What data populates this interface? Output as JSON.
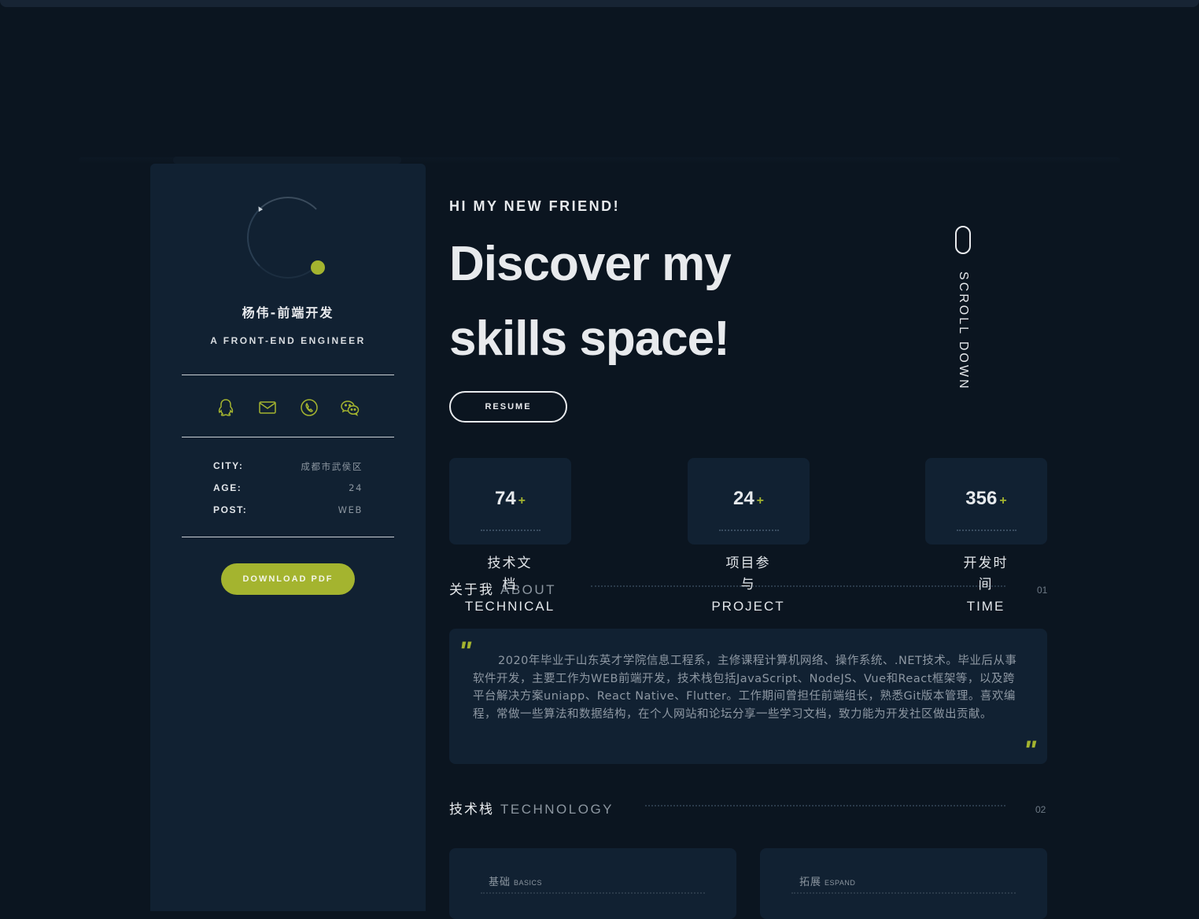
{
  "sidebar": {
    "name": "杨伟-前端开发",
    "role": "A FRONT-END ENGINEER",
    "socials": [
      {
        "icon": "qq-icon"
      },
      {
        "icon": "mail-icon"
      },
      {
        "icon": "phone-icon"
      },
      {
        "icon": "wechat-icon"
      }
    ],
    "info": [
      {
        "key": "CITY:",
        "value": "成都市武侯区"
      },
      {
        "key": "AGE:",
        "value": "24"
      },
      {
        "key": "POST:",
        "value": "WEB"
      }
    ],
    "download_label": "DOWNLOAD PDF"
  },
  "hero": {
    "greeting": "HI MY NEW FRIEND!",
    "headline_line1": "Discover my",
    "headline_line2": "skills space!",
    "resume_label": "RESUME",
    "scroll_label": "SCROLL DOWN"
  },
  "stats": [
    {
      "value": "74",
      "plus": "+",
      "label_cn": "技术文档",
      "label_en": "TECHNICAL"
    },
    {
      "value": "24",
      "plus": "+",
      "label_cn": "项目参与",
      "label_en": "PROJECT"
    },
    {
      "value": "356",
      "plus": "+",
      "label_cn": "开发时间",
      "label_en": "TIME"
    }
  ],
  "about": {
    "title_cn": "关于我",
    "title_en": "ABOUT",
    "number": "01",
    "quote_open": "\"",
    "quote_close": "\"",
    "text": "2020年毕业于山东英才学院信息工程系，主修课程计算机网络、操作系统、.NET技术。毕业后从事软件开发，主要工作为WEB前端开发，技术栈包括JavaScript、NodeJS、Vue和React框架等，以及跨平台解决方案uniapp、React Native、Flutter。工作期间曾担任前端组长，熟悉Git版本管理。喜欢编程，常做一些算法和数据结构，在个人网站和论坛分享一些学习文档，致力能为开发社区做出贡献。"
  },
  "tech": {
    "title_cn": "技术栈",
    "title_en": "TECHNOLOGY",
    "number": "02",
    "cards": [
      {
        "title_cn": "基础",
        "title_en": "BASICS"
      },
      {
        "title_cn": "拓展",
        "title_en": "ESPAND"
      }
    ]
  },
  "colors": {
    "accent": "#a4b42f",
    "background": "#0b1520",
    "card": "#112132"
  }
}
